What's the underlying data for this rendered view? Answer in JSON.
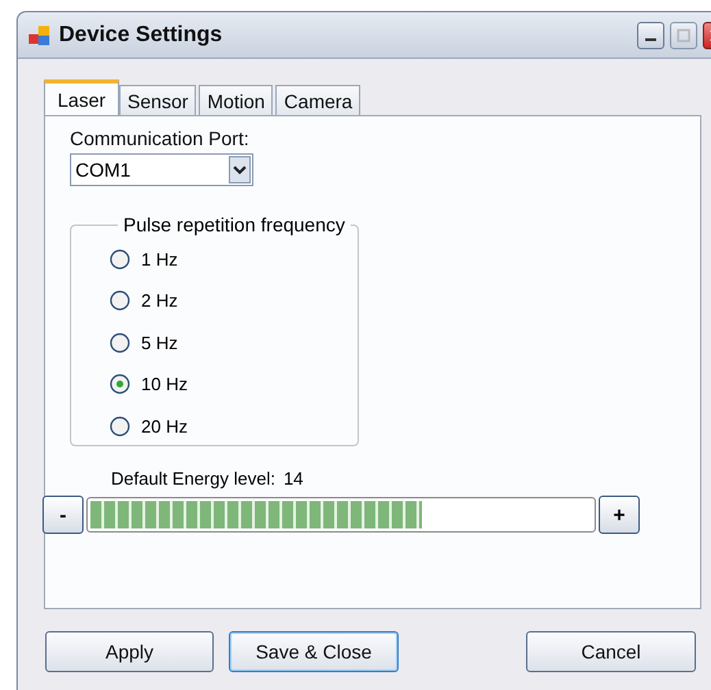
{
  "window": {
    "title": "Device Settings"
  },
  "tabs": [
    {
      "label": "Laser",
      "selected": true
    },
    {
      "label": "Sensor",
      "selected": false
    },
    {
      "label": "Motion",
      "selected": false
    },
    {
      "label": "Camera",
      "selected": false
    }
  ],
  "port": {
    "label": "Communication Port:",
    "value": "COM1"
  },
  "frequency": {
    "title": "Pulse repetition frequency",
    "options": [
      {
        "label": "1 Hz",
        "selected": false
      },
      {
        "label": "2 Hz",
        "selected": false
      },
      {
        "label": "5 Hz",
        "selected": false
      },
      {
        "label": "10 Hz",
        "selected": true
      },
      {
        "label": "20 Hz",
        "selected": false
      }
    ]
  },
  "energy": {
    "label": "Default Energy level:",
    "value": "14",
    "level": 0.66,
    "minus": "-",
    "plus": "+"
  },
  "buttons": [
    {
      "label": "Apply",
      "kind": "normal"
    },
    {
      "label": "Save & Close",
      "kind": "default"
    },
    {
      "label": "Cancel",
      "kind": "normal"
    }
  ]
}
